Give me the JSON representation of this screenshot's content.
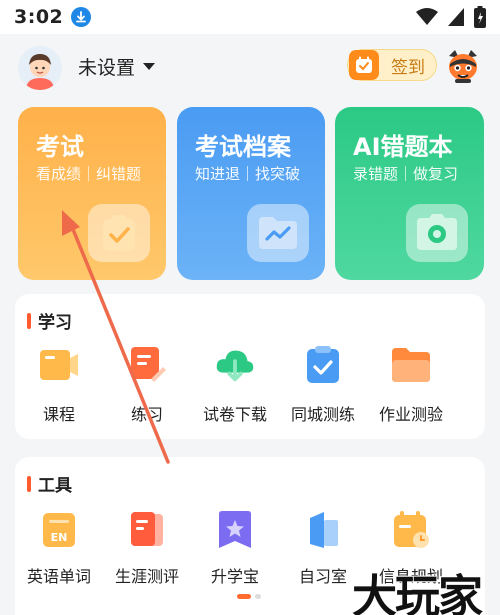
{
  "status_bar": {
    "time": "3:02",
    "icons": [
      "download-icon",
      "wifi-icon",
      "signal-icon",
      "battery-icon"
    ]
  },
  "header": {
    "username": "未设置",
    "checkin_label": "签到"
  },
  "cards": [
    {
      "title": "考试",
      "subtitle": "看成绩｜纠错题",
      "icon": "clipboard-check-icon",
      "color": "#ffb14a"
    },
    {
      "title": "考试档案",
      "subtitle": "知进退｜找突破",
      "icon": "folder-trend-icon",
      "color": "#4a9bf3"
    },
    {
      "title": "AI错题本",
      "subtitle": "录错题｜做复习",
      "icon": "camera-icon",
      "color": "#2cc985"
    }
  ],
  "study": {
    "title": "学习",
    "items": [
      {
        "label": "课程",
        "icon": "course-icon"
      },
      {
        "label": "练习",
        "icon": "practice-icon"
      },
      {
        "label": "试卷下载",
        "icon": "download-cloud-icon"
      },
      {
        "label": "同城测练",
        "icon": "local-test-icon"
      },
      {
        "label": "作业测验",
        "icon": "homework-folder-icon"
      }
    ]
  },
  "tools": {
    "title": "工具",
    "items": [
      {
        "label": "英语单词",
        "icon": "english-words-icon"
      },
      {
        "label": "生涯测评",
        "icon": "career-assessment-icon"
      },
      {
        "label": "升学宝",
        "icon": "admission-star-icon"
      },
      {
        "label": "自习室",
        "icon": "study-room-icon"
      },
      {
        "label": "信息规划",
        "icon": "calendar-plan-icon"
      }
    ]
  },
  "watermark": "大玩家",
  "colors": {
    "accent": "#ff5b2e",
    "background": "#f4f5f7"
  }
}
